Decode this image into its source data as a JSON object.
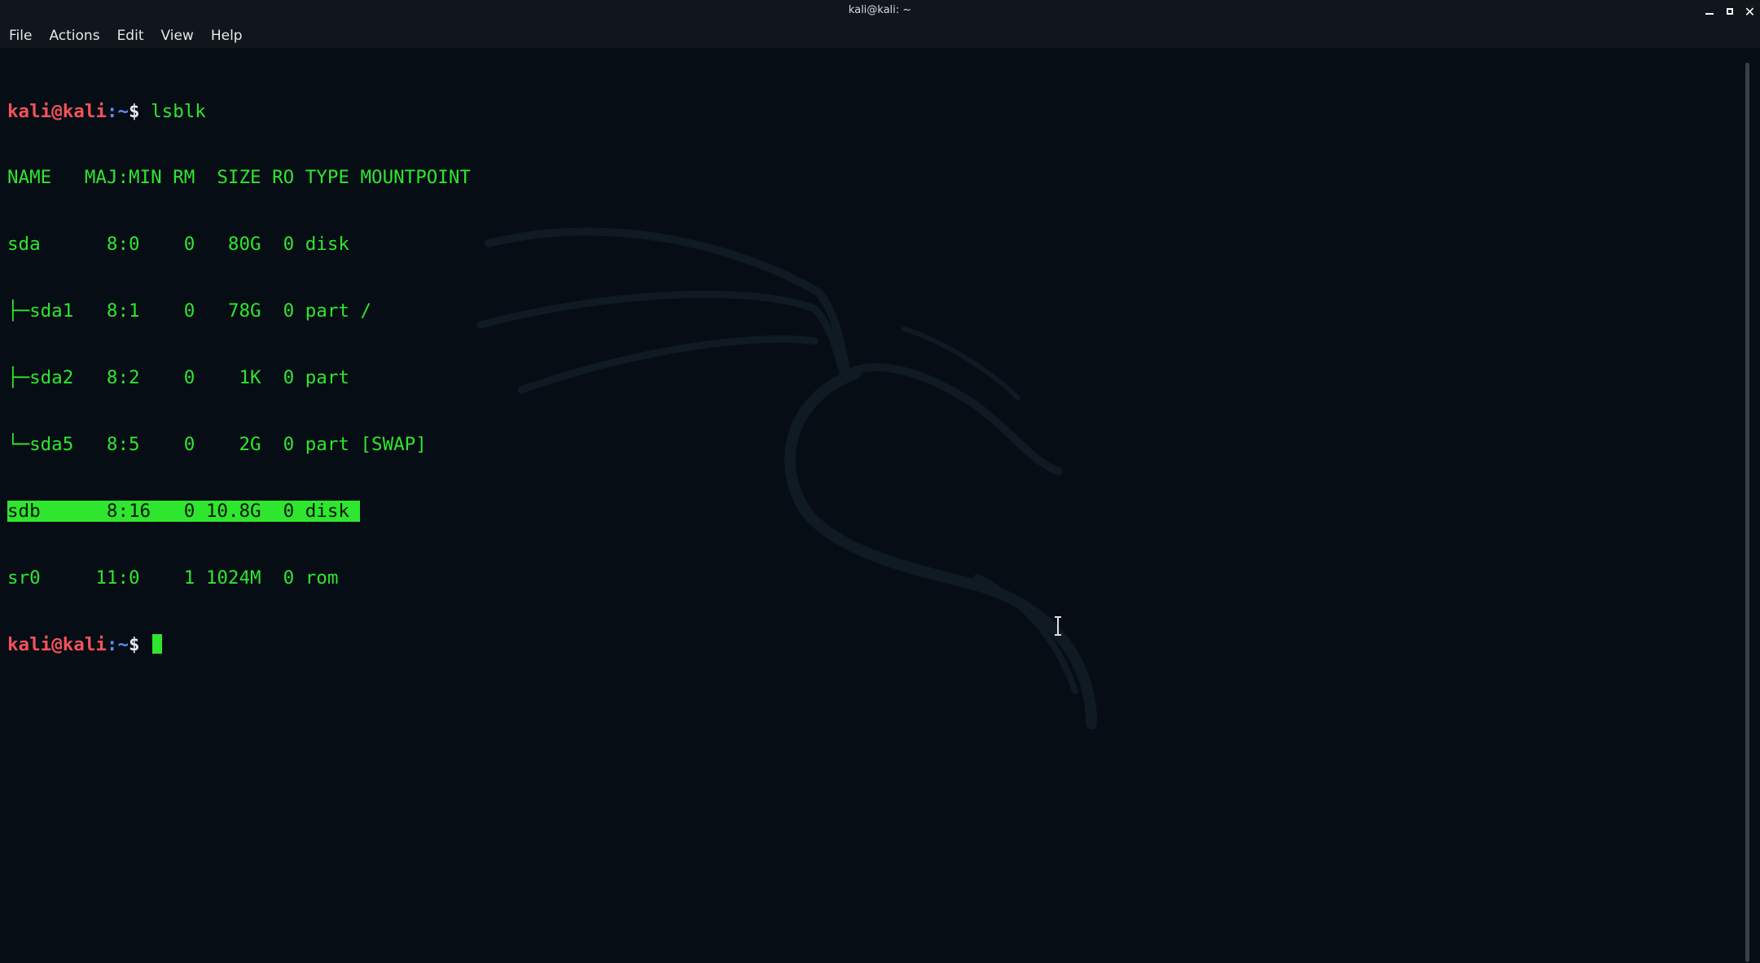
{
  "window": {
    "title": "kali@kali: ~",
    "controls": [
      "minimize",
      "maximize",
      "close"
    ]
  },
  "menu": {
    "items": [
      "File",
      "Actions",
      "Edit",
      "View",
      "Help"
    ]
  },
  "terminal": {
    "prompt_user": "kali@kali",
    "prompt_path": ":~",
    "prompt_dollar": "$",
    "command": "lsblk",
    "header": "NAME   MAJ:MIN RM  SIZE RO TYPE MOUNTPOINT",
    "rows": [
      "sda      8:0    0   80G  0 disk",
      "├─sda1   8:1    0   78G  0 part /",
      "├─sda2   8:2    0    1K  0 part",
      "└─sda5   8:5    0    2G  0 part [SWAP]",
      "sdb      8:16   0 10.8G  0 disk ",
      "sr0     11:0    1 1024M  0 rom"
    ],
    "highlighted_row": 4
  },
  "colors": {
    "text_green": "#2ee62e",
    "prompt_red": "#f4525a",
    "prompt_blue": "#5d8cff",
    "background": "#060d14"
  }
}
